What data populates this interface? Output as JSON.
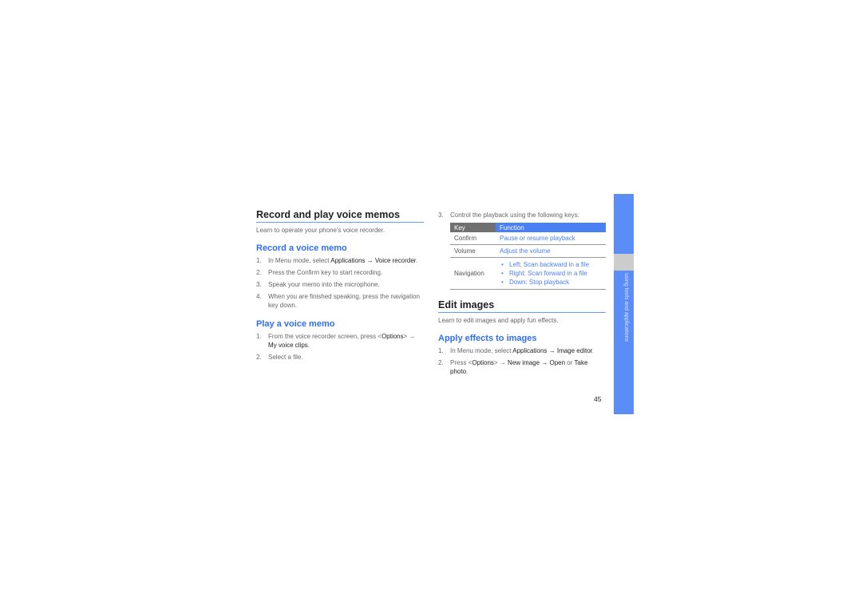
{
  "left": {
    "title": "Record and play voice memos",
    "intro": "Learn to operate your phone's voice recorder.",
    "record": {
      "heading": "Record a voice memo",
      "steps": [
        {
          "num": "1.",
          "pre": "In Menu mode, select ",
          "bold": "Applications → Voice recorder",
          "post": "."
        },
        {
          "num": "2.",
          "text": "Press the Confirm key to start recording."
        },
        {
          "num": "3.",
          "text": "Speak your memo into the microphone."
        },
        {
          "num": "4.",
          "text": "When you are finished speaking, press the navigation key down."
        }
      ]
    },
    "play": {
      "heading": "Play a voice memo",
      "steps": [
        {
          "num": "1.",
          "pre": "From the voice recorder screen, press <",
          "bold1": "Options",
          "mid": "> → ",
          "bold2": "My voice clips",
          "post": "."
        },
        {
          "num": "2.",
          "text": "Select a file."
        }
      ]
    }
  },
  "right": {
    "step3": {
      "num": "3.",
      "text": "Control the playback using the following keys:"
    },
    "table": {
      "headers": [
        "Key",
        "Function"
      ],
      "rows": [
        {
          "key": "Confirm",
          "function": "Pause or resume playback"
        },
        {
          "key": "Volume",
          "function": "Adjust the volume"
        },
        {
          "key": "Navigation",
          "functions": [
            "Left: Scan backward in a file",
            "Right: Scan forward in a file",
            "Down: Stop playback"
          ]
        }
      ]
    },
    "edit": {
      "title": "Edit images",
      "intro": "Learn to edit images and apply fun effects.",
      "heading": "Apply effects to images",
      "steps": [
        {
          "num": "1.",
          "pre": "In Menu mode, select ",
          "bold": "Applications → Image editor",
          "post": "."
        },
        {
          "num": "2.",
          "pre": "Press <",
          "bold1": "Options",
          "mid": "> → ",
          "bold2": "New image → Open",
          "mid2": " or ",
          "bold3": "Take photo",
          "post": "."
        }
      ]
    }
  },
  "side_tab": {
    "label": "using tools and applications",
    "color": "#5b8df7"
  },
  "page_number": "45"
}
